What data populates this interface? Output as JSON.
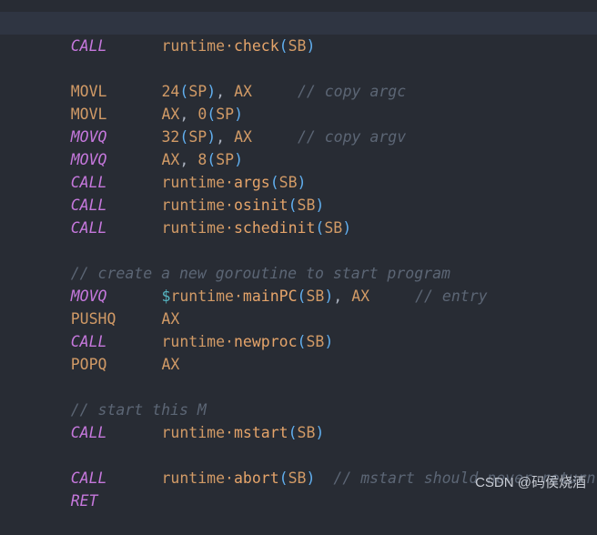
{
  "editor": {
    "theme_background": "#282c34",
    "current_line_background": "#2f3542",
    "language": "go-assembly",
    "colors": {
      "keyword": "#c678dd",
      "operation": "#d19a66",
      "function": "#e5a46a",
      "paren": "#61afef",
      "comment": "#5c6675",
      "dollar": "#56b6c2",
      "punctuation": "#abb2bf"
    }
  },
  "code": {
    "lines": [
      {
        "index": 0,
        "highlighted": true,
        "text": "    CALL    runtime·check(SB)",
        "mnemonic": "CALL",
        "operand": "runtime·check(SB)",
        "comment": ""
      },
      {
        "index": 1,
        "highlighted": false,
        "text": "",
        "mnemonic": "",
        "operand": "",
        "comment": ""
      },
      {
        "index": 2,
        "highlighted": false,
        "text": "    MOVL    24(SP), AX     // copy argc",
        "mnemonic": "MOVL",
        "operand": "24(SP), AX",
        "comment": "// copy argc"
      },
      {
        "index": 3,
        "highlighted": false,
        "text": "    MOVL    AX, 0(SP)",
        "mnemonic": "MOVL",
        "operand": "AX, 0(SP)",
        "comment": ""
      },
      {
        "index": 4,
        "highlighted": false,
        "text": "    MOVQ    32(SP), AX     // copy argv",
        "mnemonic": "MOVQ",
        "operand": "32(SP), AX",
        "comment": "// copy argv"
      },
      {
        "index": 5,
        "highlighted": false,
        "text": "    MOVQ    AX, 8(SP)",
        "mnemonic": "MOVQ",
        "operand": "AX, 8(SP)",
        "comment": ""
      },
      {
        "index": 6,
        "highlighted": false,
        "text": "    CALL    runtime·args(SB)",
        "mnemonic": "CALL",
        "operand": "runtime·args(SB)",
        "comment": ""
      },
      {
        "index": 7,
        "highlighted": false,
        "text": "    CALL    runtime·osinit(SB)",
        "mnemonic": "CALL",
        "operand": "runtime·osinit(SB)",
        "comment": ""
      },
      {
        "index": 8,
        "highlighted": false,
        "text": "    CALL    runtime·schedinit(SB)",
        "mnemonic": "CALL",
        "operand": "runtime·schedinit(SB)",
        "comment": ""
      },
      {
        "index": 9,
        "highlighted": false,
        "text": "",
        "mnemonic": "",
        "operand": "",
        "comment": ""
      },
      {
        "index": 10,
        "highlighted": false,
        "text": "    // create a new goroutine to start program",
        "mnemonic": "",
        "operand": "",
        "comment": "// create a new goroutine to start program"
      },
      {
        "index": 11,
        "highlighted": false,
        "text": "    MOVQ    $runtime·mainPC(SB), AX     // entry",
        "mnemonic": "MOVQ",
        "operand": "$runtime·mainPC(SB), AX",
        "comment": "// entry"
      },
      {
        "index": 12,
        "highlighted": false,
        "text": "    PUSHQ   AX",
        "mnemonic": "PUSHQ",
        "operand": "AX",
        "comment": ""
      },
      {
        "index": 13,
        "highlighted": false,
        "text": "    CALL    runtime·newproc(SB)",
        "mnemonic": "CALL",
        "operand": "runtime·newproc(SB)",
        "comment": ""
      },
      {
        "index": 14,
        "highlighted": false,
        "text": "    POPQ    AX",
        "mnemonic": "POPQ",
        "operand": "AX",
        "comment": ""
      },
      {
        "index": 15,
        "highlighted": false,
        "text": "",
        "mnemonic": "",
        "operand": "",
        "comment": ""
      },
      {
        "index": 16,
        "highlighted": false,
        "text": "    // start this M",
        "mnemonic": "",
        "operand": "",
        "comment": "// start this M"
      },
      {
        "index": 17,
        "highlighted": false,
        "text": "    CALL    runtime·mstart(SB)",
        "mnemonic": "CALL",
        "operand": "runtime·mstart(SB)",
        "comment": ""
      },
      {
        "index": 18,
        "highlighted": false,
        "text": "",
        "mnemonic": "",
        "operand": "",
        "comment": ""
      },
      {
        "index": 19,
        "highlighted": false,
        "text": "    CALL    runtime·abort(SB)  // mstart should never return",
        "mnemonic": "CALL",
        "operand": "runtime·abort(SB)",
        "comment": "// mstart should never return"
      },
      {
        "index": 20,
        "highlighted": false,
        "text": "    RET",
        "mnemonic": "RET",
        "operand": "",
        "comment": ""
      }
    ]
  },
  "tokens": {
    "call": "CALL",
    "movl": "MOVL",
    "movq": "MOVQ",
    "pushq": "PUSHQ",
    "popq": "POPQ",
    "ret": "RET",
    "runtime": "runtime",
    "middot": "·",
    "lparen": "(",
    "rparen": ")",
    "sb": "SB",
    "sp": "SP",
    "ax": "AX",
    "comma": ",",
    "dollar": "$",
    "fn_check": "check",
    "fn_args": "args",
    "fn_osinit": "osinit",
    "fn_schedinit": "schedinit",
    "fn_mainpc": "mainPC",
    "fn_newproc": "newproc",
    "fn_mstart": "mstart",
    "fn_abort": "abort",
    "num_24": "24",
    "num_0": "0",
    "num_32": "32",
    "num_8": "8",
    "cmt_argc": "// copy argc",
    "cmt_argv": "// copy argv",
    "cmt_goroutine": "// create a new goroutine to start program",
    "cmt_entry": "// entry",
    "cmt_startm": "// start this M",
    "cmt_abort": "// mstart should never return"
  },
  "watermark": {
    "text": "CSDN @码侯烧酒"
  }
}
